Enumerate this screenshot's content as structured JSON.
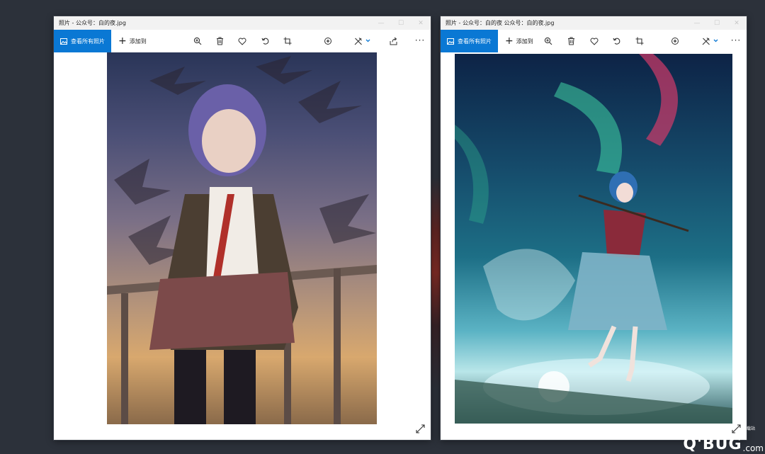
{
  "colors": {
    "accent": "#0a78d4",
    "desktop": "#2c313a",
    "window_bg": "#ffffff"
  },
  "windows": [
    {
      "title": "照片 - 公众号：白的夜.jpg",
      "see_all_label": "查看所有照片",
      "add_to_label": "添加到",
      "toolbar_icons": [
        "zoom-in-icon",
        "delete-icon",
        "heart-icon",
        "rotate-icon",
        "crop-icon",
        "enhance-icon",
        "edit-icon",
        "share-icon",
        "more-icon"
      ],
      "more_label": "···",
      "image_desc": "anime girl purple hair with birds at sunset"
    },
    {
      "title": "照片 - 公众号：白的夜 公众号：白的夜.jpg",
      "see_all_label": "查看所有照片",
      "add_to_label": "添加到",
      "toolbar_icons": [
        "zoom-in-icon",
        "delete-icon",
        "heart-icon",
        "rotate-icon",
        "crop-icon",
        "enhance-icon",
        "edit-icon",
        "more-icon"
      ],
      "more_label": "···",
      "image_desc": "anime girl blue hair violin aurora sky"
    }
  ],
  "watermark": {
    "main": "Q'BUG",
    "suffix": ".com",
    "small": "下载站"
  }
}
